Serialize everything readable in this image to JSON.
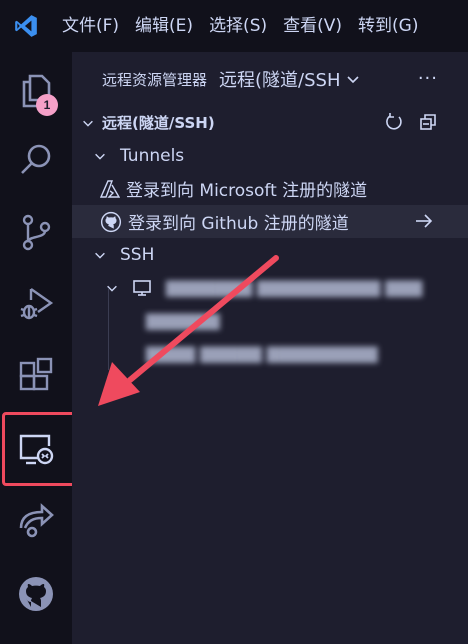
{
  "titlebar": {
    "menu": [
      "文件(F)",
      "编辑(E)",
      "选择(S)",
      "查看(V)",
      "转到(G)"
    ]
  },
  "activitybar": {
    "explorer_badge": "1",
    "items": [
      "explorer",
      "search",
      "source-control",
      "run-debug",
      "extensions",
      "remote-explorer",
      "live-share",
      "github"
    ]
  },
  "panel": {
    "title": "远程资源管理器",
    "selector_value": "远程(隧道/SSH",
    "more_label": "···",
    "section_title": "远程(隧道/SSH)",
    "tunnels_label": "Tunnels",
    "tunnel_items": [
      "登录到向 Microsoft 注册的隧道",
      "登录到向 Github 注册的隧道"
    ],
    "ssh_label": "SSH"
  },
  "colors": {
    "accent_badge": "#f5a0c8",
    "highlight": "#ef4a5e",
    "brand": "#3b8ff0"
  }
}
